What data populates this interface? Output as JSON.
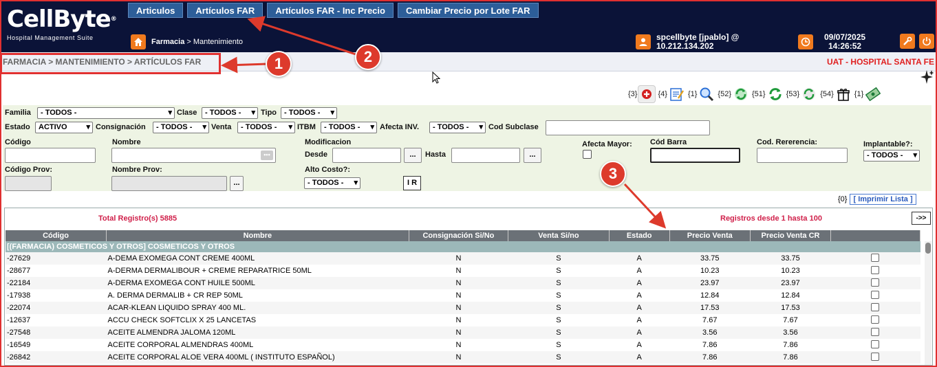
{
  "app": {
    "brand": "CellByte",
    "brand_mark": "®",
    "subtitle": "Hospital Management Suite",
    "top_tabs": [
      "Articulos",
      "Artículos FAR",
      "Artículos FAR - Inc Precio",
      "Cambiar Precio por Lote FAR"
    ],
    "crumb_bold": "Farmacia",
    "crumb_rest": " > Mantenimiento",
    "user_line1": "spcellbyte [jpablo] @",
    "user_line2": "10.212.134.202",
    "date": "09/07/2025",
    "time": "14:26:52"
  },
  "band": {
    "path": "FARMACIA > MANTENIMIENTO > ARTÍCULOS FAR",
    "environment": "UAT - HOSPITAL SANTA FE"
  },
  "toolbar": [
    {
      "count": "{3}",
      "icon": "add-icon",
      "color": "#d32020"
    },
    {
      "count": "{4}",
      "icon": "edit-form-icon",
      "color": "#2a6fd6"
    },
    {
      "count": "{1}",
      "icon": "search-icon",
      "color": "#2a6fd6"
    },
    {
      "count": "{52}",
      "icon": "refresh-green-icon",
      "color": "#1e9a3a"
    },
    {
      "count": "{51}",
      "icon": "refresh-green-icon",
      "color": "#1e9a3a"
    },
    {
      "count": "{53}",
      "icon": "refresh-cycle-icon",
      "color": "#1e9a3a"
    },
    {
      "count": "{54}",
      "icon": "gift-icon",
      "color": "#111111"
    },
    {
      "count": "{1}",
      "icon": "money-icon",
      "color": "#1e7a3a"
    }
  ],
  "filters": {
    "familia_label": "Familia",
    "familia_value": "- TODOS -",
    "clase_label": "Clase",
    "clase_value": "- TODOS -",
    "tipo_label": "Tipo",
    "tipo_value": "- TODOS -",
    "estado_label": "Estado",
    "estado_value": "ACTIVO",
    "consignacion_label": "Consignación",
    "consignacion_value": "- TODOS -",
    "venta_label": "Venta",
    "venta_value": "- TODOS -",
    "itbm_label": "ITBM",
    "itbm_value": "- TODOS -",
    "afecta_inv_label": "Afecta INV.",
    "afecta_inv_value": "- TODOS -",
    "cod_subclase_label": "Cod Subclase",
    "codigo_label": "Código",
    "nombre_label": "Nombre",
    "modificacion_label": "Modificacion",
    "desde_label": "Desde",
    "hasta_label": "Hasta",
    "afecta_mayor_label": "Afecta Mayor:",
    "cod_barra_label": "Cód Barra",
    "cod_referencia_label": "Cod. Rererencia:",
    "implantable_label": "Implantable?:",
    "implantable_value": "- TODOS -",
    "codigo_prov_label": "Código Prov:",
    "nombre_prov_label": "Nombre Prov:",
    "alto_costo_label": "Alto Costo?:",
    "alto_costo_value": "- TODOS -",
    "dots": "...",
    "ir": "I R"
  },
  "print": {
    "count": "{0}",
    "label": "[ Imprimir Lista ]"
  },
  "grid": {
    "total": "Total Registro(s) 5885",
    "range": "Registros desde 1 hasta 100",
    "next": "->>",
    "columns": [
      "Código",
      "Nombre",
      "Consignación Si/No",
      "Venta Si/no",
      "Estado",
      "Precio Venta",
      "Precio Venta CR",
      ""
    ],
    "group": "[(FARMACIA) COSMETICOS Y OTROS] COSMETICOS Y OTROS",
    "rows": [
      [
        "-27629",
        "A-DEMA EXOMEGA CONT CREME 400ML",
        "N",
        "S",
        "A",
        "33.75",
        "33.75"
      ],
      [
        "-28677",
        "A-DERMA DERMALIBOUR + CREME REPARATRICE 50ML",
        "N",
        "S",
        "A",
        "10.23",
        "10.23"
      ],
      [
        "-22184",
        "A-DERMA EXOMEGA CONT HUILE 500ML",
        "N",
        "S",
        "A",
        "23.97",
        "23.97"
      ],
      [
        "-17938",
        "A. DERMA DERMALIB + CR REP 50ML",
        "N",
        "S",
        "A",
        "12.84",
        "12.84"
      ],
      [
        "-22074",
        "ACAR-KLEAN LIQUIDO SPRAY 400 ML.",
        "N",
        "S",
        "A",
        "17.53",
        "17.53"
      ],
      [
        "-12637",
        "ACCU CHECK SOFTCLIX X 25 LANCETAS",
        "N",
        "S",
        "A",
        "7.67",
        "7.67"
      ],
      [
        "-27548",
        "ACEITE ALMENDRA JALOMA 120ML",
        "N",
        "S",
        "A",
        "3.56",
        "3.56"
      ],
      [
        "-16549",
        "ACEITE CORPORAL ALMENDRAS 400ML",
        "N",
        "S",
        "A",
        "7.86",
        "7.86"
      ],
      [
        "-26842",
        "ACEITE CORPORAL ALOE VERA 400ML ( INSTITUTO ESPAÑOL)",
        "N",
        "S",
        "A",
        "7.86",
        "7.86"
      ]
    ]
  },
  "annotations": [
    "1",
    "2",
    "3"
  ]
}
